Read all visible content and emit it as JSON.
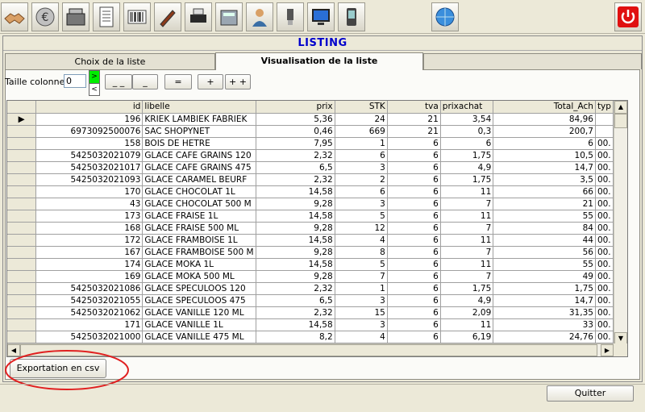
{
  "toolbar": {
    "icons": [
      "handshake-icon",
      "euro-icon",
      "cash-register-icon",
      "document-icon",
      "barcode-icon",
      "pen-icon",
      "printer-icon",
      "calculator-icon",
      "user-icon",
      "usb-icon",
      "monitor-icon",
      "pda-icon",
      "globe-icon",
      "power-icon"
    ],
    "power_color": "#e01010"
  },
  "listing": {
    "title": "LISTING"
  },
  "tabs": [
    {
      "label": "Choix de la liste"
    },
    {
      "label": "Visualisation de la liste"
    },
    {
      "label": ""
    }
  ],
  "controls": {
    "col_label": "Taille colonne",
    "col_value": "0",
    "arrow_up": ">",
    "arrow_down": "<",
    "buttons": [
      "_ _",
      "_",
      "=",
      "+",
      "+ +"
    ]
  },
  "grid": {
    "headers": [
      "id",
      "libelle",
      "prix",
      "STK",
      "tva",
      "prixachat",
      "Total_Ach",
      "typ"
    ],
    "rows": [
      [
        "196",
        "KRIEK LAMBIEK FABRIEK",
        "5,36",
        "24",
        "21",
        "3,54",
        "84,96",
        ""
      ],
      [
        "6973092500076",
        "SAC SHOPYNET",
        "0,46",
        "669",
        "21",
        "0,3",
        "200,7",
        ""
      ],
      [
        "158",
        "BOIS DE HETRE",
        "7,95",
        "1",
        "6",
        "6",
        "6",
        "00."
      ],
      [
        "5425032021079",
        "GLACE CAFE GRAINS 120",
        "2,32",
        "6",
        "6",
        "1,75",
        "10,5",
        "00."
      ],
      [
        "5425032021017",
        "GLACE CAFE GRAINS 475",
        "6,5",
        "3",
        "6",
        "4,9",
        "14,7",
        "00."
      ],
      [
        "5425032021093",
        "GLACE CARAMEL BEURF",
        "2,32",
        "2",
        "6",
        "1,75",
        "3,5",
        "00."
      ],
      [
        "170",
        "GLACE CHOCOLAT 1L",
        "14,58",
        "6",
        "6",
        "11",
        "66",
        "00."
      ],
      [
        "43",
        "GLACE CHOCOLAT 500 M",
        "9,28",
        "3",
        "6",
        "7",
        "21",
        "00."
      ],
      [
        "173",
        "GLACE FRAISE 1L",
        "14,58",
        "5",
        "6",
        "11",
        "55",
        "00."
      ],
      [
        "168",
        "GLACE FRAISE 500 ML",
        "9,28",
        "12",
        "6",
        "7",
        "84",
        "00."
      ],
      [
        "172",
        "GLACE FRAMBOISE 1L",
        "14,58",
        "4",
        "6",
        "11",
        "44",
        "00."
      ],
      [
        "167",
        "GLACE FRAMBOISE 500 M",
        "9,28",
        "8",
        "6",
        "7",
        "56",
        "00."
      ],
      [
        "174",
        "GLACE MOKA 1L",
        "14,58",
        "5",
        "6",
        "11",
        "55",
        "00."
      ],
      [
        "169",
        "GLACE MOKA 500 ML",
        "9,28",
        "7",
        "6",
        "7",
        "49",
        "00."
      ],
      [
        "5425032021086",
        "GLACE SPECULOOS 120",
        "2,32",
        "1",
        "6",
        "1,75",
        "1,75",
        "00."
      ],
      [
        "5425032021055",
        "GLACE SPECULOOS 475",
        "6,5",
        "3",
        "6",
        "4,9",
        "14,7",
        "00."
      ],
      [
        "5425032021062",
        "GLACE VANILLE 120 ML",
        "2,32",
        "15",
        "6",
        "2,09",
        "31,35",
        "00."
      ],
      [
        "171",
        "GLACE VANILLE 1L",
        "14,58",
        "3",
        "6",
        "11",
        "33",
        "00."
      ],
      [
        "5425032021000",
        "GLACE VANILLE 475 ML",
        "8,2",
        "4",
        "6",
        "6,19",
        "24,76",
        "00."
      ]
    ]
  },
  "footer": {
    "export_label": "Exportation en csv",
    "quit_label": "Quitter",
    "highlight_color": "#e02020"
  }
}
